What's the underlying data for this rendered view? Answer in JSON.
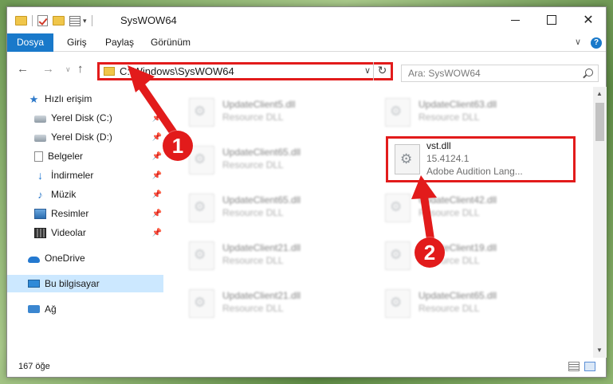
{
  "window": {
    "title": "SysWOW64",
    "minimize_icon": "minimize-icon",
    "maximize_icon": "maximize-icon",
    "close_label": "✕"
  },
  "ribbon": {
    "tabs": [
      {
        "label": "Dosya",
        "active": true
      },
      {
        "label": "Giriş"
      },
      {
        "label": "Paylaş"
      },
      {
        "label": "Görünüm"
      }
    ],
    "help_label": "?"
  },
  "address": {
    "path": "C:\\Windows\\SysWOW64",
    "search_placeholder": "Ara: SysWOW64"
  },
  "nav": {
    "items": [
      {
        "label": "Hızlı erişim",
        "icon": "star-icon"
      },
      {
        "label": "Yerel Disk (C:)",
        "icon": "disk-icon",
        "pinned": true
      },
      {
        "label": "Yerel Disk (D:)",
        "icon": "disk-icon",
        "pinned": true
      },
      {
        "label": "Belgeler",
        "icon": "documents-icon",
        "pinned": true
      },
      {
        "label": "İndirmeler",
        "icon": "download-icon",
        "pinned": true
      },
      {
        "label": "Müzik",
        "icon": "music-icon",
        "pinned": true
      },
      {
        "label": "Resimler",
        "icon": "pictures-icon",
        "pinned": true
      },
      {
        "label": "Videolar",
        "icon": "videos-icon",
        "pinned": true
      },
      {
        "label": "OneDrive",
        "icon": "cloud-icon"
      },
      {
        "label": "Bu bilgisayar",
        "icon": "computer-icon",
        "selected": true
      },
      {
        "label": "Ağ",
        "icon": "network-icon"
      }
    ]
  },
  "files": [
    {
      "name": "UpdateClient5.dll",
      "type": "Resource DLL"
    },
    {
      "name": "UpdateClient63.dll",
      "type": "Resource DLL"
    },
    {
      "name": "UpdateClient65.dll",
      "type": "Resource DLL"
    },
    {
      "name": "UpdateClient65.dll",
      "type": "Resource DLL"
    },
    {
      "name": "UpdateClient42.dll",
      "type": "Resource DLL"
    },
    {
      "name": "UpdateClient21.dll",
      "type": "Resource DLL"
    },
    {
      "name": "UpdateClient19.dll",
      "type": "Resource DLL"
    },
    {
      "name": "UpdateClient21.dll",
      "type": "Resource DLL"
    },
    {
      "name": "UpdateClient65.dll",
      "type": "Resource DLL"
    }
  ],
  "highlighted_file": {
    "name": "vst.dll",
    "version": "15.4124.1",
    "description": "Adobe Audition Lang..."
  },
  "status": {
    "item_count": "167 öğe"
  },
  "annotations": {
    "badge_1": "1",
    "badge_2": "2",
    "color": "#e21b1b"
  }
}
